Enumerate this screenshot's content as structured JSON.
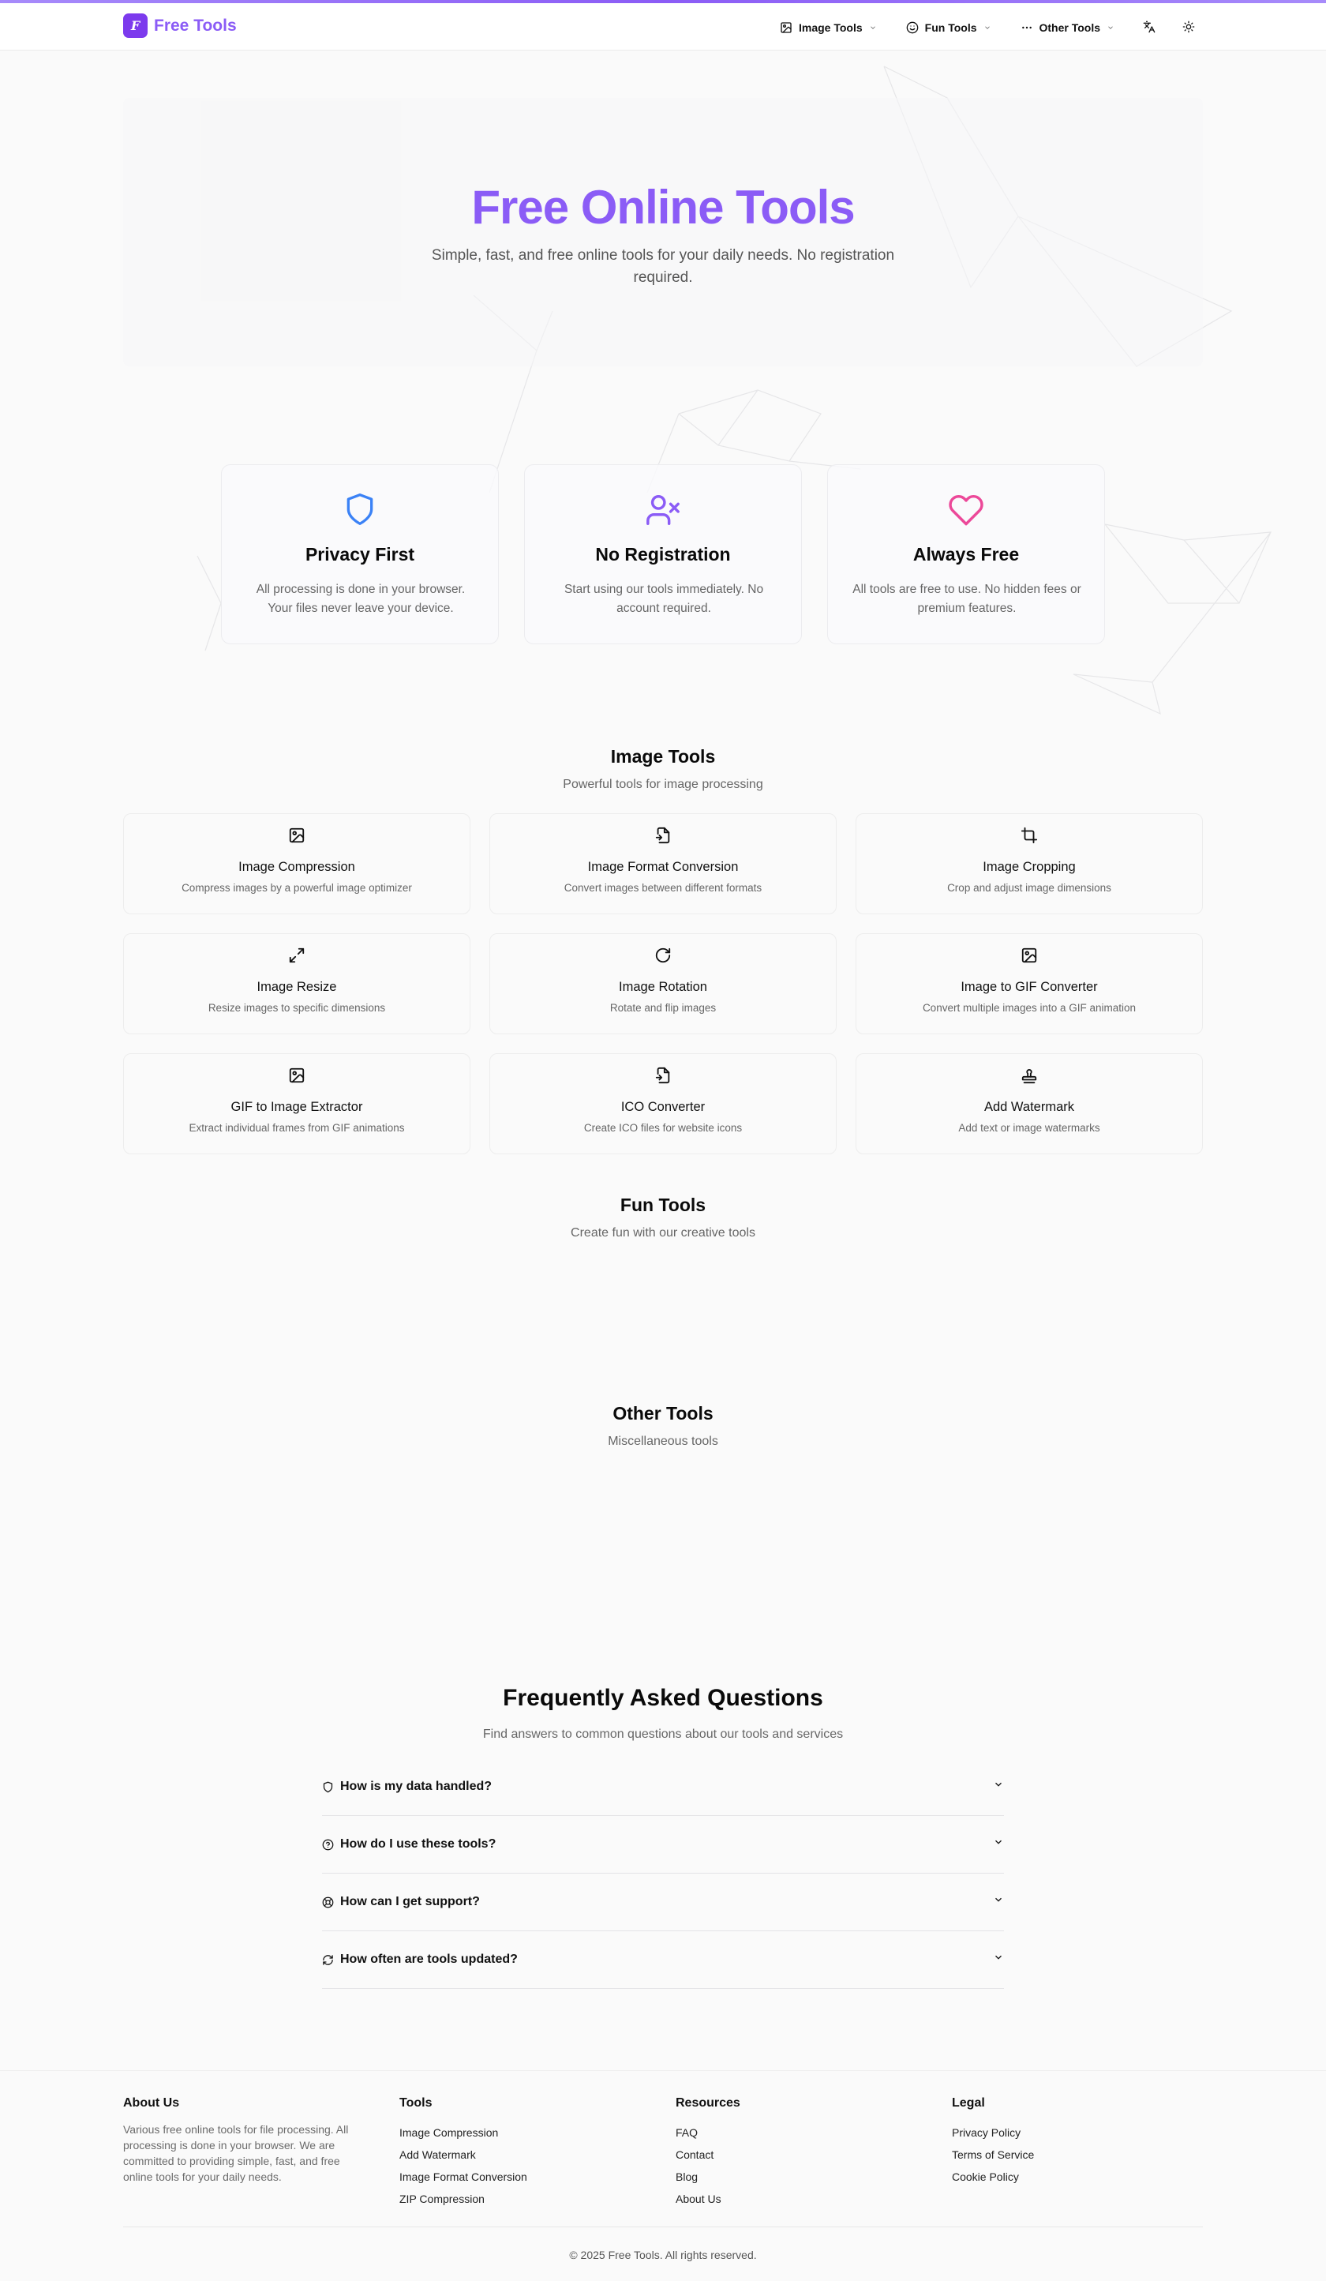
{
  "header": {
    "logo_text": "Free Tools",
    "logo_glyph": "F",
    "nav": [
      {
        "label": "Image Tools",
        "icon": "image-icon"
      },
      {
        "label": "Fun Tools",
        "icon": "smile-icon"
      },
      {
        "label": "Other Tools",
        "icon": "more-icon"
      }
    ],
    "icons": [
      "translate-icon",
      "theme-sun-icon"
    ]
  },
  "hero": {
    "title": "Free Online Tools",
    "subtitle": "Simple, fast, and free online tools for your daily needs. No registration required."
  },
  "features": [
    {
      "title": "Privacy First",
      "text": "All processing is done in your browser. Your files never leave your device.",
      "icon": "shield-icon",
      "color": "#3b82f6"
    },
    {
      "title": "No Registration",
      "text": "Start using our tools immediately. No account required.",
      "icon": "user-x-icon",
      "color": "#8b5cf6"
    },
    {
      "title": "Always Free",
      "text": "All tools are free to use. No hidden fees or premium features.",
      "icon": "heart-icon",
      "color": "#ec4899"
    }
  ],
  "image_tools": {
    "title": "Image Tools",
    "subtitle": "Powerful tools for image processing",
    "items": [
      {
        "name": "Image Compression",
        "desc": "Compress images by a powerful image optimizer",
        "icon": "image-icon"
      },
      {
        "name": "Image Format Conversion",
        "desc": "Convert images between different formats",
        "icon": "file-convert-icon"
      },
      {
        "name": "Image Cropping",
        "desc": "Crop and adjust image dimensions",
        "icon": "crop-icon"
      },
      {
        "name": "Image Resize",
        "desc": "Resize images to specific dimensions",
        "icon": "expand-icon"
      },
      {
        "name": "Image Rotation",
        "desc": "Rotate and flip images",
        "icon": "rotate-icon"
      },
      {
        "name": "Image to GIF Converter",
        "desc": "Convert multiple images into a GIF animation",
        "icon": "image-icon"
      },
      {
        "name": "GIF to Image Extractor",
        "desc": "Extract individual frames from GIF animations",
        "icon": "image-icon"
      },
      {
        "name": "ICO Converter",
        "desc": "Create ICO files for website icons",
        "icon": "file-convert-icon"
      },
      {
        "name": "Add Watermark",
        "desc": "Add text or image watermarks",
        "icon": "stamp-icon"
      }
    ]
  },
  "fun_tools": {
    "title": "Fun Tools",
    "subtitle": "Create fun with our creative tools"
  },
  "other_tools": {
    "title": "Other Tools",
    "subtitle": "Miscellaneous tools"
  },
  "faq": {
    "title": "Frequently Asked Questions",
    "subtitle": "Find answers to common questions about our tools and services",
    "items": [
      {
        "q": "How is my data handled?",
        "icon": "shield-small-icon"
      },
      {
        "q": "How do I use these tools?",
        "icon": "help-circle-icon"
      },
      {
        "q": "How can I get support?",
        "icon": "lifebuoy-icon"
      },
      {
        "q": "How often are tools updated?",
        "icon": "refresh-icon"
      }
    ]
  },
  "footer": {
    "about_title": "About Us",
    "about_text": "Various free online tools for file processing. All processing is done in your browser. We are committed to providing simple, fast, and free online tools for your daily needs.",
    "tools_title": "Tools",
    "tools": [
      "Image Compression",
      "Add Watermark",
      "Image Format Conversion",
      "ZIP Compression"
    ],
    "resources_title": "Resources",
    "resources": [
      "FAQ",
      "Contact",
      "Blog",
      "About Us"
    ],
    "legal_title": "Legal",
    "legal": [
      "Privacy Policy",
      "Terms of Service",
      "Cookie Policy"
    ],
    "copyright": "© 2025 Free Tools. All rights reserved."
  }
}
